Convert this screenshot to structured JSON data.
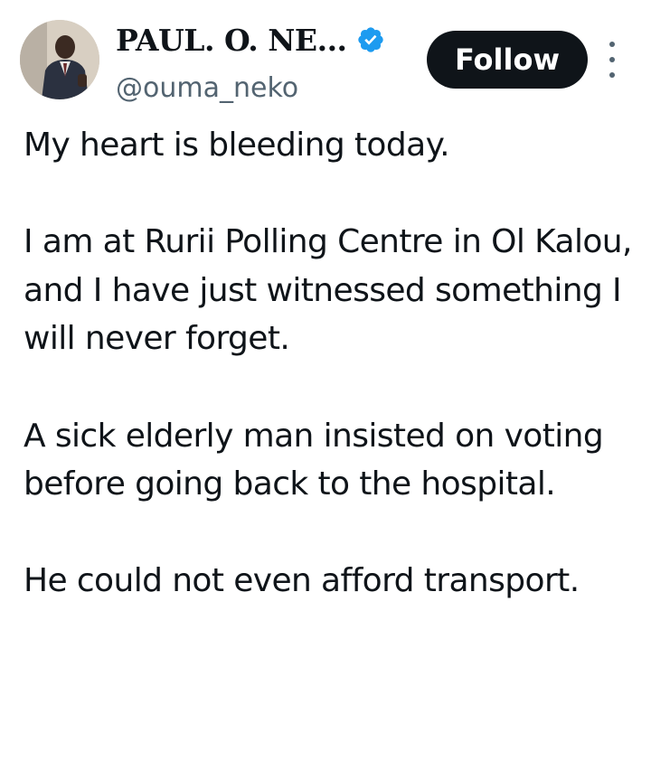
{
  "author": {
    "display_name": "PAUL. O. NE...",
    "handle": "@ouma_neko",
    "verified": true,
    "verified_color": "#1d9bf0"
  },
  "actions": {
    "follow_label": "Follow",
    "more_icon": "more-vertical-icon"
  },
  "tweet": {
    "paragraphs": [
      "My heart is bleeding today.",
      "I am at Rurii Polling Centre in Ol Kalou, and I have just witnessed something I will never forget.",
      "A sick elderly man insisted on voting before going back to the hospital.",
      "He could not even afford transport."
    ]
  },
  "colors": {
    "text": "#0f1419",
    "secondary": "#536471",
    "button_bg": "#0f1419",
    "button_text": "#ffffff"
  }
}
